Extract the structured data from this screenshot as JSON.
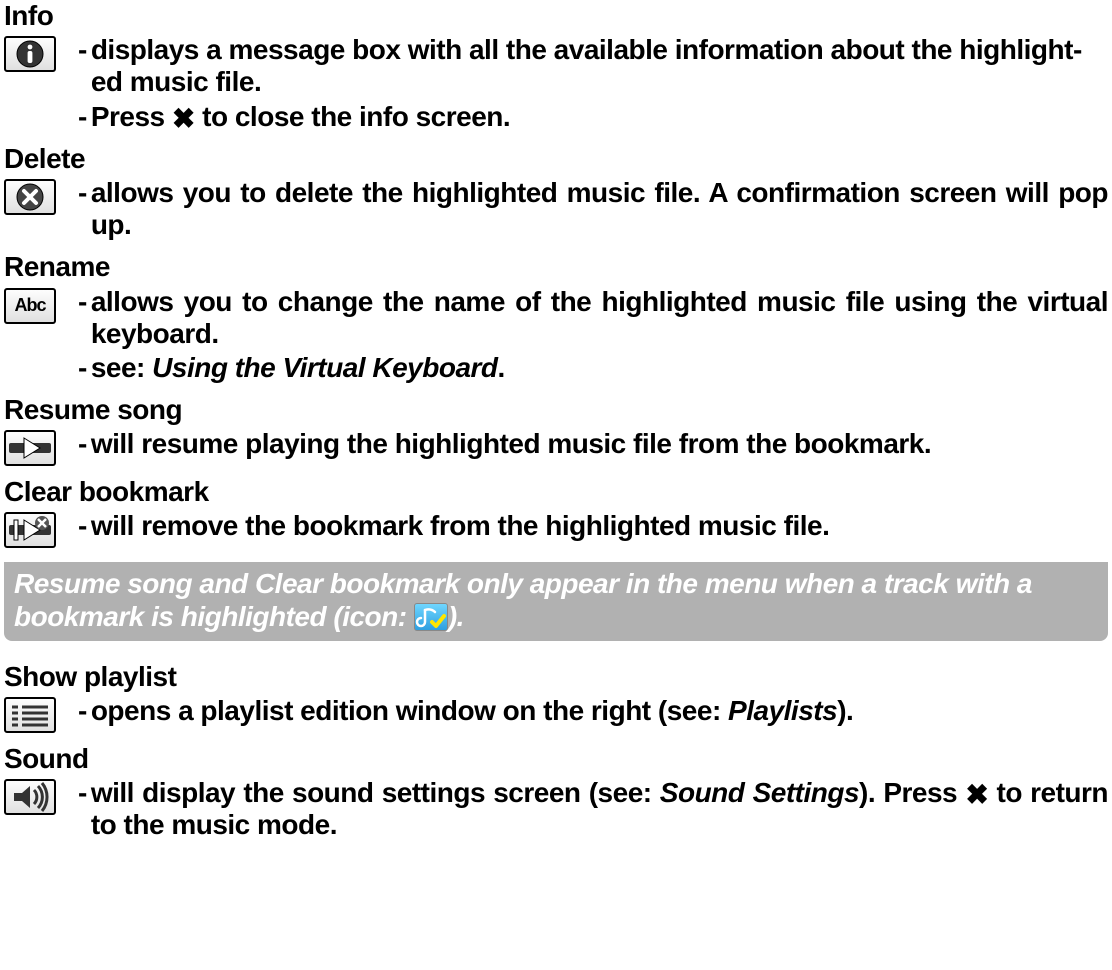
{
  "sections": {
    "info": {
      "title": "Info",
      "b1a": "displays a message box with all the available information about the highlight",
      "b1b": "ed music file.",
      "b2a": "Press ",
      "b2b": " to close the info screen."
    },
    "delete": {
      "title": "Delete",
      "b1": "allows you to delete the highlighted music file. A confirmation screen will pop up."
    },
    "rename": {
      "title": "Rename",
      "b1": "allows you to change the name of the highlighted music file using the virtual keyboard.",
      "b2a": "see: ",
      "b2b": "Using the Virtual Keyboard",
      "b2c": "."
    },
    "resume": {
      "title": "Resume song",
      "b1": "will resume playing the highlighted music file from the bookmark."
    },
    "clear": {
      "title": "Clear bookmark",
      "b1": "will remove the bookmark from the highlighted music file."
    },
    "note": {
      "a": "Resume song and Clear bookmark only appear in the menu when a track with a bookmark is highlighted (icon: ",
      "b": ")."
    },
    "show": {
      "title": "Show playlist",
      "b1a": "opens a playlist edition window on the right (see: ",
      "b1b": "Playlists",
      "b1c": ")."
    },
    "sound": {
      "title": "Sound",
      "b1a": "will display the sound settings screen (see: ",
      "b1b": "Sound Settings",
      "b1c": "). Press ",
      "b1d": " to return to the music mode."
    }
  }
}
